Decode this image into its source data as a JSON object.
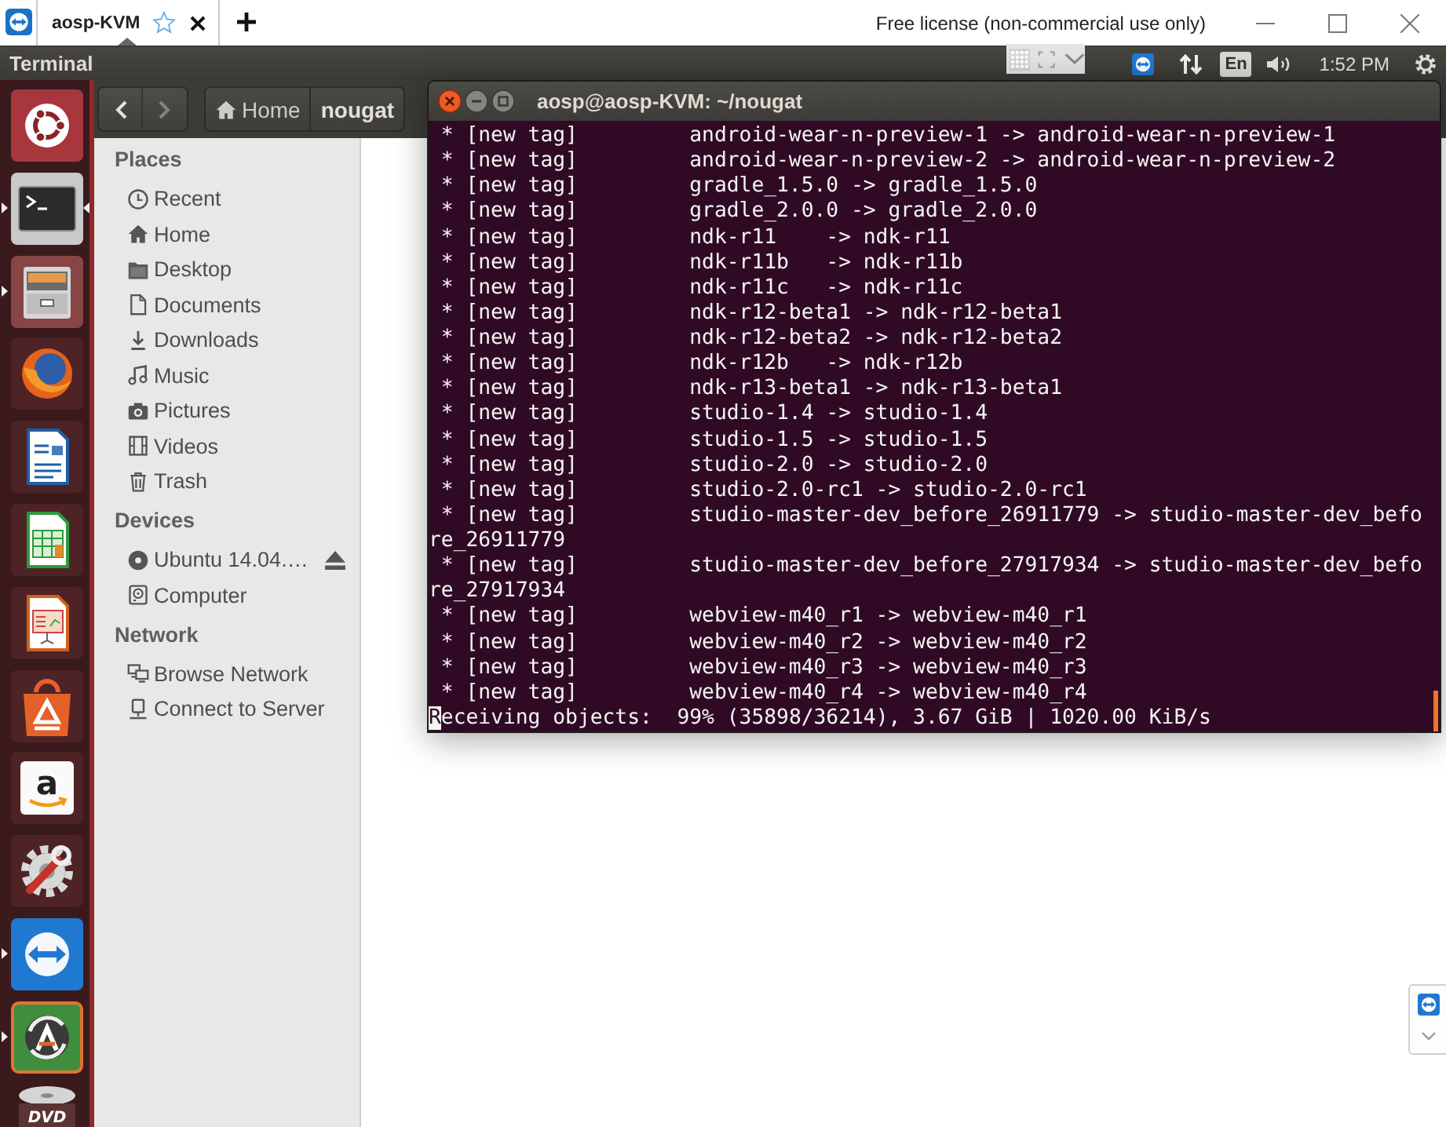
{
  "tabs": [
    {
      "label": "aosp-KVM",
      "selected": true,
      "starred": false
    }
  ],
  "license_text": "Free license (non-commercial use only)",
  "panel": {
    "app_name": "Terminal",
    "keyboard_layout": "En",
    "clock": "1:52 PM"
  },
  "launcher": [
    {
      "kind": "dash",
      "running": false,
      "focused": false
    },
    {
      "kind": "terminal",
      "running": true,
      "focused": true
    },
    {
      "kind": "files",
      "running": true,
      "focused": false
    },
    {
      "kind": "browser",
      "running": false,
      "focused": false
    },
    {
      "kind": "writer",
      "running": false,
      "focused": false
    },
    {
      "kind": "calc",
      "running": false,
      "focused": false
    },
    {
      "kind": "impress",
      "running": false,
      "focused": false
    },
    {
      "kind": "store",
      "running": false,
      "focused": false
    },
    {
      "kind": "amazon",
      "label": "a",
      "running": false,
      "focused": false
    },
    {
      "kind": "settings",
      "running": false,
      "focused": false
    },
    {
      "kind": "teamviewer",
      "running": true,
      "focused": false
    },
    {
      "kind": "updater",
      "running": true,
      "focused": false
    },
    {
      "kind": "dvd",
      "label": "DVD",
      "running": false,
      "focused": false
    }
  ],
  "file_manager": {
    "nav": [
      {
        "kind": "back",
        "disabled": false
      },
      {
        "kind": "forward",
        "disabled": true
      }
    ],
    "path": [
      {
        "kind": "home",
        "label": "Home",
        "selected": false
      },
      {
        "kind": "folder",
        "label": "nougat",
        "selected": true
      }
    ],
    "sidebar": [
      {
        "title": "Places",
        "items": [
          {
            "kind": "recent",
            "label": "Recent",
            "selected": false
          },
          {
            "kind": "home",
            "label": "Home",
            "selected": false
          },
          {
            "kind": "desktop",
            "label": "Desktop",
            "selected": false
          },
          {
            "kind": "documents",
            "label": "Documents",
            "selected": false
          },
          {
            "kind": "downloads",
            "label": "Downloads",
            "selected": false
          },
          {
            "kind": "music",
            "label": "Music",
            "selected": false
          },
          {
            "kind": "pictures",
            "label": "Pictures",
            "selected": false
          },
          {
            "kind": "videos",
            "label": "Videos",
            "selected": false
          },
          {
            "kind": "trash",
            "label": "Trash",
            "selected": false
          }
        ]
      },
      {
        "title": "Devices",
        "items": [
          {
            "kind": "drive",
            "label": "Ubuntu 14.04.…",
            "selected": false,
            "ejectable": true
          },
          {
            "kind": "computer",
            "label": "Computer",
            "selected": false,
            "ejectable": false
          }
        ]
      },
      {
        "title": "Network",
        "items": [
          {
            "kind": "network",
            "label": "Browse Network",
            "selected": false
          },
          {
            "kind": "server",
            "label": "Connect to Server",
            "selected": false
          }
        ]
      }
    ]
  },
  "terminal": {
    "title": "aosp@aosp-KVM: ~/nougat",
    "lines": [
      " * [new tag]         android-wear-n-preview-1 -> android-wear-n-preview-1",
      " * [new tag]         android-wear-n-preview-2 -> android-wear-n-preview-2",
      " * [new tag]         gradle_1.5.0 -> gradle_1.5.0",
      " * [new tag]         gradle_2.0.0 -> gradle_2.0.0",
      " * [new tag]         ndk-r11    -> ndk-r11",
      " * [new tag]         ndk-r11b   -> ndk-r11b",
      " * [new tag]         ndk-r11c   -> ndk-r11c",
      " * [new tag]         ndk-r12-beta1 -> ndk-r12-beta1",
      " * [new tag]         ndk-r12-beta2 -> ndk-r12-beta2",
      " * [new tag]         ndk-r12b   -> ndk-r12b",
      " * [new tag]         ndk-r13-beta1 -> ndk-r13-beta1",
      " * [new tag]         studio-1.4 -> studio-1.4",
      " * [new tag]         studio-1.5 -> studio-1.5",
      " * [new tag]         studio-2.0 -> studio-2.0",
      " * [new tag]         studio-2.0-rc1 -> studio-2.0-rc1",
      " * [new tag]         studio-master-dev_before_26911779 -> studio-master-dev_befo",
      "re_26911779",
      " * [new tag]         studio-master-dev_before_27917934 -> studio-master-dev_befo",
      "re_27917934",
      " * [new tag]         webview-m40_r1 -> webview-m40_r1",
      " * [new tag]         webview-m40_r2 -> webview-m40_r2",
      " * [new tag]         webview-m40_r3 -> webview-m40_r3",
      " * [new tag]         webview-m40_r4 -> webview-m40_r4"
    ],
    "status_line": {
      "text": "Receiving objects:  99% (35898/36214), 3.67 GiB | 1020.00 KiB/s",
      "cursor": true
    }
  }
}
